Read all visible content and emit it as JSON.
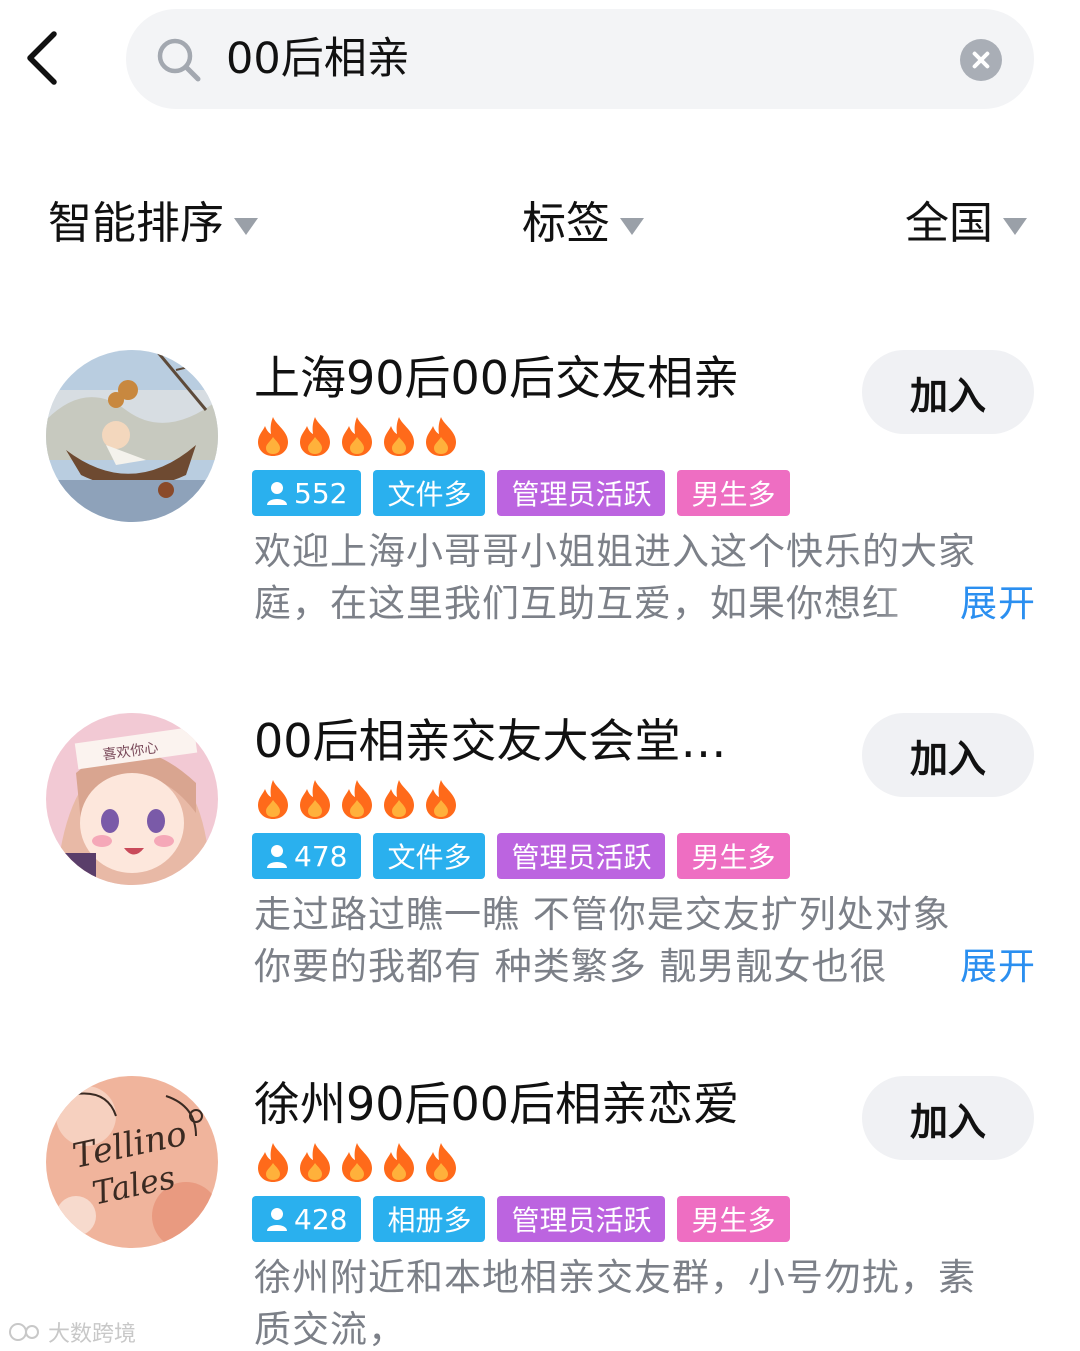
{
  "search": {
    "query": "00后相亲"
  },
  "filters": {
    "sort": "智能排序",
    "tag": "标签",
    "region": "全国"
  },
  "groups": [
    {
      "title": "上海90后00后交友相亲",
      "join_label": "加入",
      "flames": 5,
      "members": "552",
      "tags": [
        "文件多",
        "管理员活跃",
        "男生多"
      ],
      "desc_line1": "欢迎上海小哥哥小姐姐进入这个快乐的大家",
      "desc_line2": "庭，在这里我们互助互爱，如果你想红",
      "expand": "展开"
    },
    {
      "title": "00后相亲交友大会堂…",
      "join_label": "加入",
      "flames": 5,
      "members": "478",
      "tags": [
        "文件多",
        "管理员活跃",
        "男生多"
      ],
      "desc_line1": "走过路过瞧一瞧 不管你是交友扩列处对象",
      "desc_line2": "你要的我都有 种类繁多 靓男靓女也很",
      "expand": "展开"
    },
    {
      "title": "徐州90后00后相亲恋爱",
      "join_label": "加入",
      "flames": 5,
      "members": "428",
      "tags": [
        "相册多",
        "管理员活跃",
        "男生多"
      ],
      "desc_line1": "徐州附近和本地相亲交友群，小号勿扰，素",
      "desc_line2": "质交流，",
      "expand": ""
    }
  ],
  "avatar1_text": "",
  "avatar2_text": "喜欢你心",
  "avatar3_text": "Tellino Tales",
  "watermark": "大数跨境",
  "colors": {
    "member_tag": "#2ab0ee",
    "purple_tag": "#bc64e0",
    "pink_tag": "#ee6ec2",
    "expand": "#2b8ff0",
    "flame": "#ff6a1a"
  }
}
